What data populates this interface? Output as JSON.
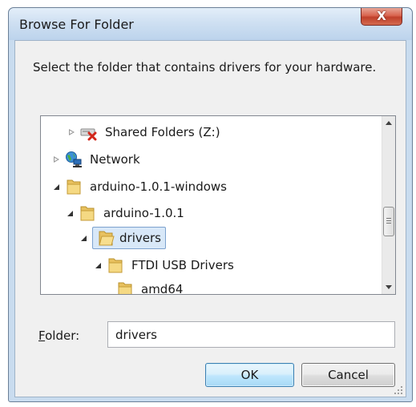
{
  "window": {
    "title": "Browse For Folder",
    "close_glyph": "X"
  },
  "instructions": "Select the folder that contains drivers for your hardware.",
  "tree": {
    "items": [
      {
        "label": "Shared Folders (Z:)",
        "icon": "network-drive-disconnected-icon",
        "expander": "collapsed"
      },
      {
        "label": "Network",
        "icon": "network-icon",
        "expander": "collapsed"
      },
      {
        "label": "arduino-1.0.1-windows",
        "icon": "folder-icon",
        "expander": "expanded"
      },
      {
        "label": "arduino-1.0.1",
        "icon": "folder-icon",
        "expander": "expanded"
      },
      {
        "label": "drivers",
        "icon": "folder-open-icon",
        "expander": "expanded",
        "selected": true
      },
      {
        "label": "FTDI USB Drivers",
        "icon": "folder-icon",
        "expander": "expanded"
      },
      {
        "label": "amd64",
        "icon": "folder-icon",
        "expander": "none"
      }
    ]
  },
  "folder_field": {
    "label_accel": "F",
    "label_rest": "older:",
    "value": "drivers"
  },
  "buttons": {
    "ok": "OK",
    "cancel": "Cancel"
  },
  "colors": {
    "selection_bg": "#d8e8f8",
    "selection_border": "#7da2ce",
    "ok_border": "#3c7fb1",
    "close_red": "#c0402b"
  }
}
